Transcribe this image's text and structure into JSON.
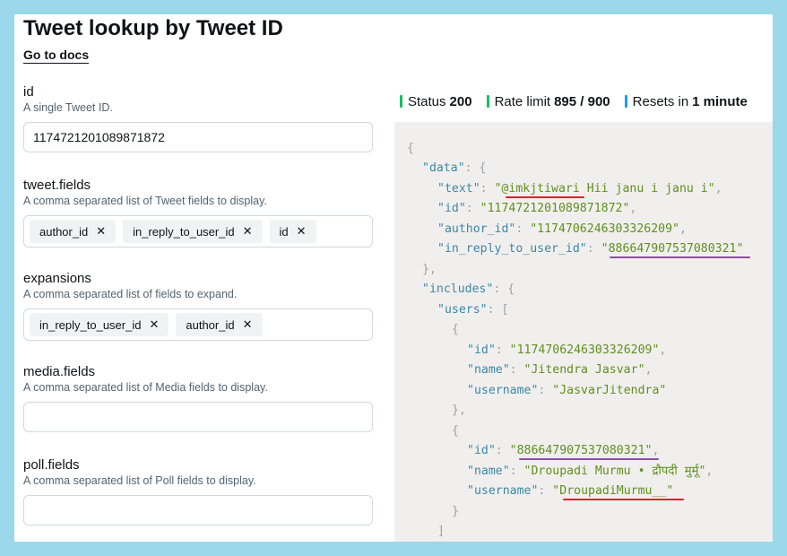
{
  "page": {
    "title": "Tweet lookup by Tweet ID",
    "docs_link": "Go to docs"
  },
  "fields": {
    "id": {
      "label": "id",
      "desc": "A single Tweet ID.",
      "value": "1174721201089871872"
    },
    "tweet_fields": {
      "label": "tweet.fields",
      "desc": "A comma separated list of Tweet fields to display.",
      "chips": [
        "author_id",
        "in_reply_to_user_id",
        "id"
      ]
    },
    "expansions": {
      "label": "expansions",
      "desc": "A comma separated list of fields to expand.",
      "chips": [
        "in_reply_to_user_id",
        "author_id"
      ]
    },
    "media_fields": {
      "label": "media.fields",
      "desc": "A comma separated list of Media fields to display.",
      "value": ""
    },
    "poll_fields": {
      "label": "poll.fields",
      "desc": "A comma separated list of Poll fields to display.",
      "value": ""
    }
  },
  "chip_remove_symbol": "✕",
  "status": {
    "status_label": "Status",
    "status_value": "200",
    "rate_label": "Rate limit",
    "rate_value": "895 / 900",
    "reset_label": "Resets in",
    "reset_value": "1 minute",
    "colors": {
      "ok": "#17bf63",
      "info": "#1d9bf0"
    }
  },
  "json": {
    "open_brace": "{",
    "data_key": "\"data\"",
    "text_key": "\"text\"",
    "text_mention": "@imkjtiwari",
    "text_rest": " Hii janu i janu i",
    "id_key": "\"id\"",
    "id_value": "\"1174721201089871872\"",
    "author_id_key": "\"author_id\"",
    "author_id_value": "\"1174706246303326209\"",
    "reply_key": "\"in_reply_to_user_id\"",
    "reply_value": "886647907537080321",
    "includes_key": "\"includes\"",
    "users_key": "\"users\"",
    "user1_id": "\"1174706246303326209\"",
    "name_key": "\"name\"",
    "user1_name": "\"Jitendra Jasvar\"",
    "username_key": "\"username\"",
    "user1_username": "\"JasvarJitendra\"",
    "user2_id": "886647907537080321",
    "user2_name": "\"Droupadi Murmu • द्रौपदी मुर्मू\"",
    "user2_username": "DroupadiMurmu__",
    "annotation_colors": {
      "red": "#e0202a",
      "purple": "#8e4f9e"
    }
  }
}
